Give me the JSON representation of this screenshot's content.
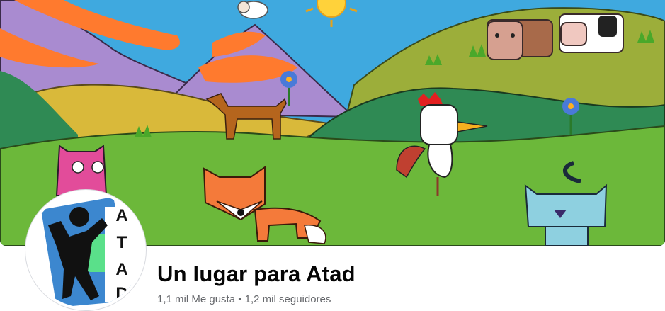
{
  "page": {
    "name": "Un lugar para Atad",
    "likes": "1,1 mil Me gusta",
    "separator": "•",
    "followers": "1,2 mil seguidores"
  },
  "avatar": {
    "letters": [
      "A",
      "T",
      "A",
      "D"
    ]
  },
  "colors": {
    "sky": "#3fa9df",
    "avatar_blue": "#3c87cf",
    "avatar_green": "#5ae08a",
    "text_primary": "#050505",
    "text_secondary": "#65676b"
  }
}
